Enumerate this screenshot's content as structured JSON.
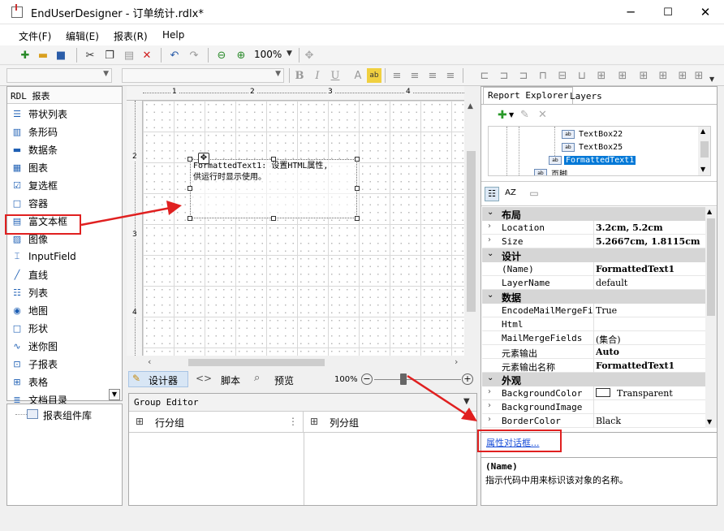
{
  "window": {
    "title": "EndUserDesigner - 订单统计.rdlx*",
    "minimize": "─",
    "maximize": "☐",
    "close": "✕"
  },
  "menu": [
    "文件(F)",
    "编辑(E)",
    "报表(R)",
    "Help"
  ],
  "toolbar": {
    "zoom": "100%"
  },
  "format_toolbar": {
    "bold": "B",
    "italic": "I",
    "underline": "U"
  },
  "toolbox": {
    "header": "RDL 报表",
    "items": [
      {
        "label": "带状列表",
        "icon": "list-band-icon"
      },
      {
        "label": "条形码",
        "icon": "barcode-icon"
      },
      {
        "label": "数据条",
        "icon": "databar-icon"
      },
      {
        "label": "图表",
        "icon": "chart-icon"
      },
      {
        "label": "复选框",
        "icon": "checkbox-icon"
      },
      {
        "label": "容器",
        "icon": "container-icon"
      },
      {
        "label": "富文本框",
        "icon": "richtext-icon"
      },
      {
        "label": "图像",
        "icon": "image-icon"
      },
      {
        "label": "InputField",
        "icon": "inputfield-icon"
      },
      {
        "label": "直线",
        "icon": "line-icon"
      },
      {
        "label": "列表",
        "icon": "list-icon"
      },
      {
        "label": "地图",
        "icon": "globe-icon"
      },
      {
        "label": "形状",
        "icon": "shape-icon"
      },
      {
        "label": "迷你图",
        "icon": "sparkline-icon"
      },
      {
        "label": "子报表",
        "icon": "subreport-icon"
      },
      {
        "label": "表格",
        "icon": "table-icon"
      },
      {
        "label": "文档目录",
        "icon": "toc-icon"
      }
    ],
    "library": "报表组件库"
  },
  "ruler": {
    "h": [
      "1",
      "2",
      "3",
      "4"
    ],
    "v": [
      "2",
      "3",
      "4"
    ]
  },
  "canvas": {
    "formatted_text": "FormattedText1: 设置HTML属性,\n供运行时显示使用。"
  },
  "design_tabs": {
    "designer": "设计器",
    "script": "脚本",
    "preview": "预览",
    "zoom": "100%"
  },
  "group_editor": {
    "title": "Group Editor",
    "row_groups": "行分组",
    "column_groups": "列分组"
  },
  "report_explorer": {
    "tabs": [
      "Report Explorer",
      "Layers"
    ],
    "tree": [
      {
        "label": "TextBox22",
        "selected": false
      },
      {
        "label": "TextBox25",
        "selected": false
      },
      {
        "label": "FormattedText1",
        "selected": true
      },
      {
        "label": "页脚",
        "selected": false
      }
    ]
  },
  "properties": {
    "rows": [
      {
        "type": "category",
        "name": "布局"
      },
      {
        "type": "prop",
        "name": "Location",
        "value": "3.2cm, 5.2cm",
        "bold": true,
        "expandable": true
      },
      {
        "type": "prop",
        "name": "Size",
        "value": "5.2667cm, 1.8115cm",
        "bold": true,
        "expandable": true
      },
      {
        "type": "category",
        "name": "设计"
      },
      {
        "type": "prop",
        "name": "(Name)",
        "value": "FormattedText1",
        "bold": true
      },
      {
        "type": "prop",
        "name": "LayerName",
        "value": "default",
        "bold": false
      },
      {
        "type": "category",
        "name": "数据"
      },
      {
        "type": "prop",
        "name": "EncodeMailMergeFields",
        "value": "True",
        "bold": false
      },
      {
        "type": "prop",
        "name": "Html",
        "value": "",
        "bold": false
      },
      {
        "type": "prop",
        "name": "MailMergeFields",
        "value": "(集合)",
        "bold": false
      },
      {
        "type": "prop",
        "name": "元素输出",
        "value": "Auto",
        "bold": true
      },
      {
        "type": "prop",
        "name": "元素输出名称",
        "value": "FormattedText1",
        "bold": true
      },
      {
        "type": "category",
        "name": "外观"
      },
      {
        "type": "prop",
        "name": "BackgroundColor",
        "value": "Transparent",
        "bold": false,
        "expandable": true,
        "swatch": "#ffffff"
      },
      {
        "type": "prop",
        "name": "BackgroundImage",
        "value": "",
        "bold": false,
        "expandable": true
      },
      {
        "type": "prop",
        "name": "BorderColor",
        "value": "Black",
        "bold": false,
        "expandable": true
      }
    ],
    "dialog_link": "属性对话框...",
    "desc_title": "(Name)",
    "desc_text": "指示代码中用来标识该对象的名称。"
  },
  "accent_red": "#e02020",
  "selection_blue": "#0078d7"
}
